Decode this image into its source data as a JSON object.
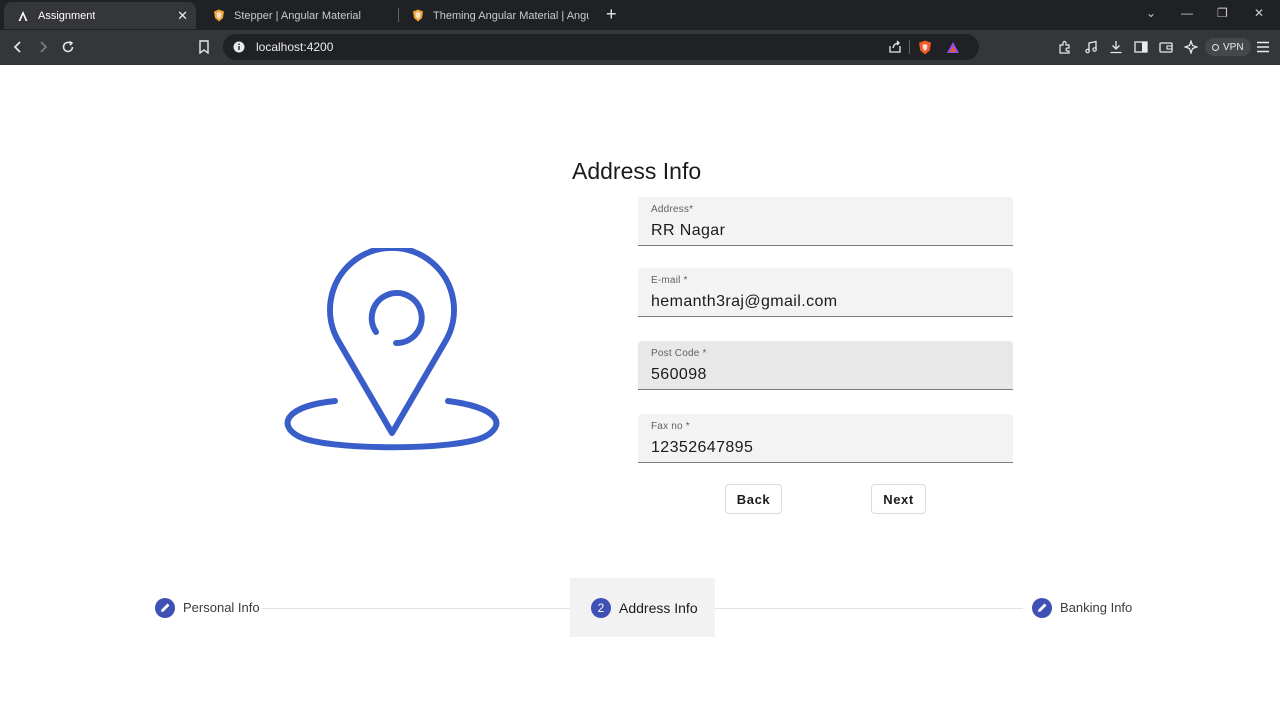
{
  "browser": {
    "tabs": [
      {
        "title": "Assignment",
        "active": true
      },
      {
        "title": "Stepper | Angular Material",
        "active": false
      },
      {
        "title": "Theming Angular Material | Angular",
        "active": false
      }
    ],
    "url": "localhost:4200",
    "vpn_label": "VPN"
  },
  "page": {
    "section_title": "Address Info",
    "fields": [
      {
        "label": "Address*",
        "value": "RR Nagar"
      },
      {
        "label": "E-mail *",
        "value": "hemanth3raj@gmail.com"
      },
      {
        "label": "Post Code *",
        "value": "560098"
      },
      {
        "label": "Fax no *",
        "value": "12352647895"
      }
    ],
    "buttons": {
      "back": "Back",
      "next": "Next"
    },
    "illustration": "location-pin-icon"
  },
  "stepper": {
    "steps": [
      {
        "label": "Personal Info",
        "state": "edit",
        "icon": "pencil-icon"
      },
      {
        "label": "Address Info",
        "state": "active",
        "number": "2"
      },
      {
        "label": "Banking Info",
        "state": "edit",
        "icon": "pencil-icon"
      }
    ]
  },
  "colors": {
    "accent": "#3f51b5",
    "illustration": "#3a5ec9"
  }
}
